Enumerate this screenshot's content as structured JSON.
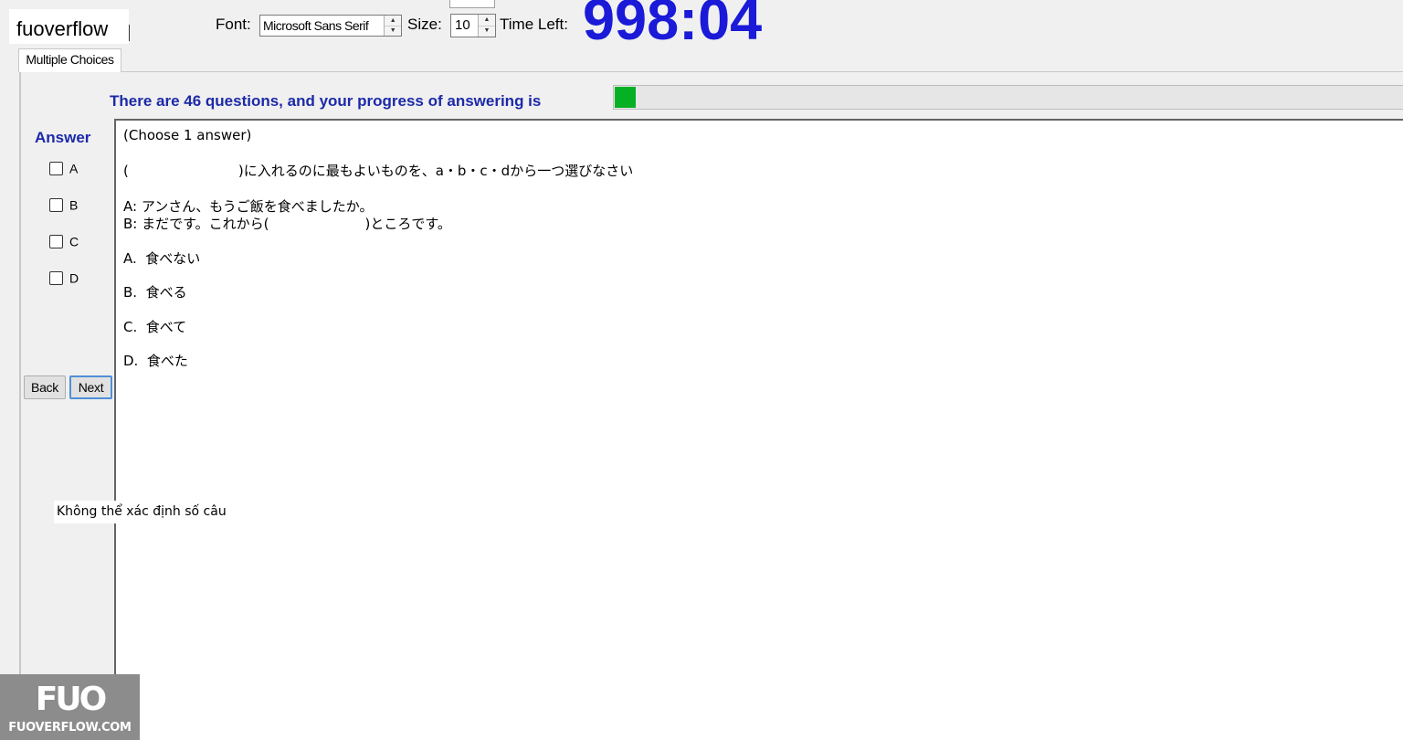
{
  "watermark": {
    "top_text": "fuoverflow",
    "logo_mark": "FUO",
    "logo_text": "FUOVERFLOW.COM"
  },
  "toolbar": {
    "font_label": "Font:",
    "font_value": "Microsoft Sans Serif",
    "size_label": "Size:",
    "size_value": "10",
    "time_left_label": "Time Left:",
    "time_left_value": "998:04"
  },
  "tabs": [
    {
      "label": "Multiple Choices",
      "active": true
    }
  ],
  "progress": {
    "text": "There are 46 questions, and your progress of answering is",
    "fraction": 0.027,
    "fill_color": "#06b025"
  },
  "answer_panel": {
    "title": "Answer",
    "options": [
      {
        "label": "A",
        "checked": false
      },
      {
        "label": "B",
        "checked": false
      },
      {
        "label": "C",
        "checked": false
      },
      {
        "label": "D",
        "checked": false
      }
    ],
    "back_label": "Back",
    "next_label": "Next"
  },
  "question": {
    "instruction": "(Choose 1 answer)",
    "prompt": "(　　　　　　　　)に入れるのに最もよいものを、a・b・c・dから一つ選びなさい",
    "dialog_a": "A: アンさん、もうご飯を食べましたか。",
    "dialog_b": "B: まだです。これから(　　　　　　　)ところです。",
    "choices": [
      "A.  食べない",
      "B.  食べる",
      "C.  食べて",
      "D.  食べた"
    ]
  },
  "status": {
    "text": "Không thể xác định số câu"
  },
  "colors": {
    "accent_blue": "#1c2aa8",
    "timer_blue": "#1a1ad8"
  }
}
